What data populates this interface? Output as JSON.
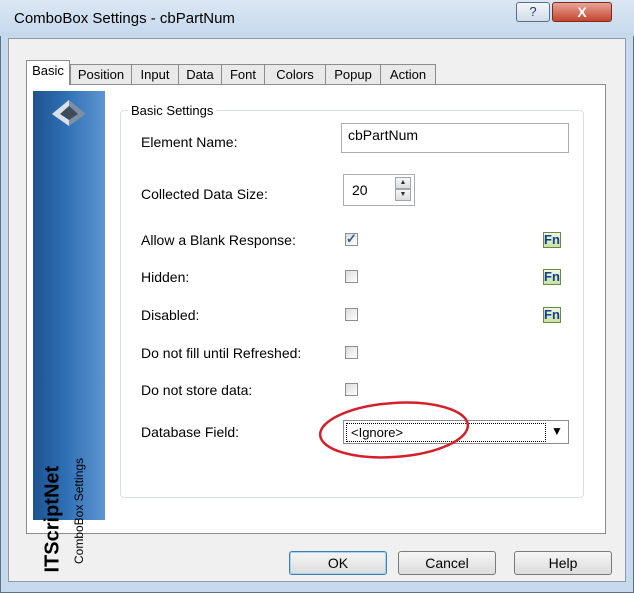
{
  "window": {
    "title": "ComboBox Settings - cbPartNum",
    "help_glyph": "?",
    "close_glyph": "X"
  },
  "tabs": [
    "Basic",
    "Position",
    "Input",
    "Data",
    "Font",
    "Colors",
    "Popup",
    "Action"
  ],
  "active_tab": "Basic",
  "banner": {
    "brand": "ITScriptNet",
    "subtitle": "ComboBox Settings"
  },
  "group": {
    "label": "Basic Settings"
  },
  "fields": {
    "element_name": {
      "label": "Element Name:",
      "value": "cbPartNum"
    },
    "collected_size": {
      "label": "Collected Data Size:",
      "value": "20"
    },
    "allow_blank": {
      "label": "Allow a Blank Response:",
      "checked": true,
      "fn": "Fn"
    },
    "hidden": {
      "label": "Hidden:",
      "checked": false,
      "fn": "Fn"
    },
    "disabled": {
      "label": "Disabled:",
      "checked": false,
      "fn": "Fn"
    },
    "no_fill": {
      "label": "Do not fill until Refreshed:",
      "checked": false
    },
    "no_store": {
      "label": "Do not store data:",
      "checked": false
    },
    "db_field": {
      "label": "Database Field:",
      "value": "<Ignore>"
    }
  },
  "buttons": {
    "ok": "OK",
    "cancel": "Cancel",
    "help": "Help"
  },
  "colors": {
    "annotation": "#d4202a",
    "banner": "#2f6fb4"
  }
}
